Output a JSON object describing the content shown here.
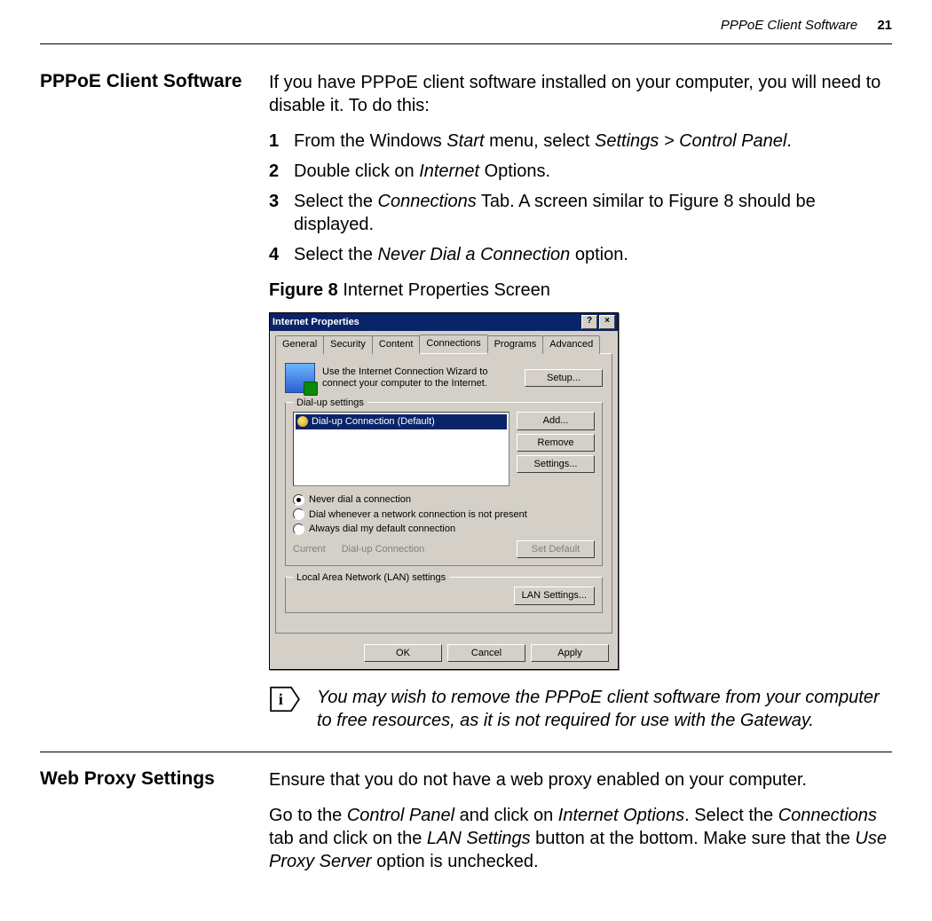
{
  "header": {
    "running_title": "PPPoE Client Software",
    "page_number": "21"
  },
  "section1": {
    "title": "PPPoE Client Software",
    "intro": "If you have PPPoE client software installed on your computer, you will need to disable it. To do this:",
    "steps": [
      {
        "num": "1",
        "pre": "From the Windows ",
        "em1": "Start",
        "mid": " menu, select ",
        "em2": "Settings > Control Panel",
        "post": "."
      },
      {
        "num": "2",
        "pre": "Double click on ",
        "em1": "Internet",
        "mid": " Options.",
        "em2": "",
        "post": ""
      },
      {
        "num": "3",
        "pre": "Select the ",
        "em1": "Connections",
        "mid": " Tab. A screen similar to Figure 8 should be displayed.",
        "em2": "",
        "post": ""
      },
      {
        "num": "4",
        "pre": "Select the ",
        "em1": "Never Dial a Connection",
        "mid": " option.",
        "em2": "",
        "post": ""
      }
    ],
    "figure": {
      "label": "Figure 8",
      "caption": "   Internet Properties Screen"
    },
    "dialog": {
      "title": "Internet Properties",
      "close": "×",
      "help": "?",
      "tabs": [
        "General",
        "Security",
        "Content",
        "Connections",
        "Programs",
        "Advanced"
      ],
      "active_tab_index": 3,
      "wizard_text": "Use the Internet Connection Wizard to connect your computer to the Internet.",
      "setup_btn": "Setup...",
      "dialup_legend": "Dial-up settings",
      "list_item": "Dial-up Connection (Default)",
      "add_btn": "Add...",
      "remove_btn": "Remove",
      "settings_btn": "Settings...",
      "radio1": "Never dial a connection",
      "radio2": "Dial whenever a network connection is not present",
      "radio3": "Always dial my default connection",
      "current_label": "Current",
      "current_value": "Dial-up Connection",
      "setdefault_btn": "Set Default",
      "lan_legend": "Local Area Network (LAN) settings",
      "lan_btn": "LAN Settings...",
      "ok_btn": "OK",
      "cancel_btn": "Cancel",
      "apply_btn": "Apply"
    },
    "info_note": "You may wish to remove the PPPoE client software from your computer to free resources, as it is not required for use with the Gateway."
  },
  "section2": {
    "title": "Web Proxy Settings",
    "p1": "Ensure that you do not have a web proxy enabled on your computer.",
    "p2_a": "Go to the ",
    "p2_em1": "Control Panel",
    "p2_b": " and click on ",
    "p2_em2": "Internet Options",
    "p2_c": ". Select the ",
    "p2_em3": "Connections",
    "p2_d": " tab and click on the ",
    "p2_em4": "LAN Settings",
    "p2_e": " button at the bottom. Make sure that the ",
    "p2_em5": "Use Proxy Server",
    "p2_f": " option is unchecked."
  }
}
